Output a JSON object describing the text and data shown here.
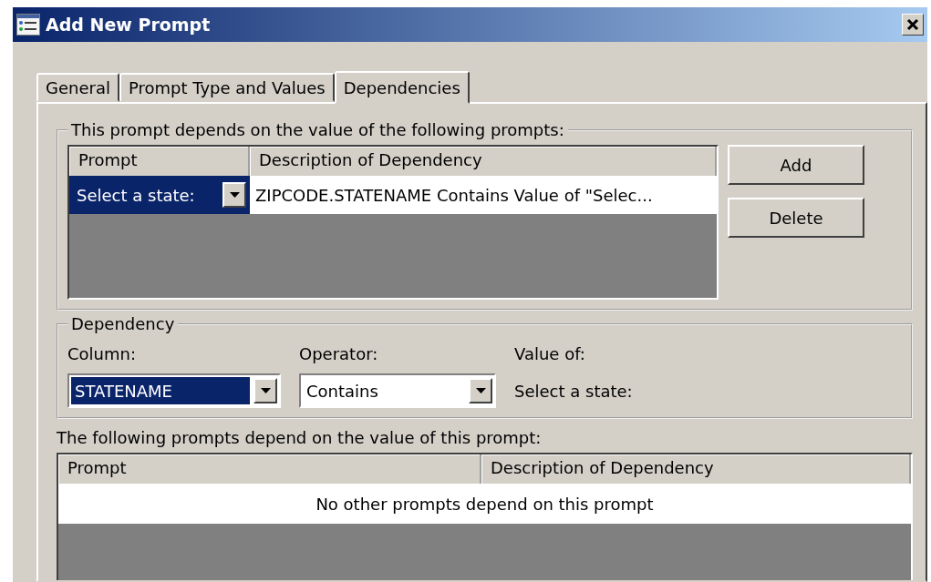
{
  "window": {
    "title": "Add New Prompt"
  },
  "tabs": [
    {
      "label": "General",
      "selected": false
    },
    {
      "label": "Prompt Type and Values",
      "selected": false
    },
    {
      "label": "Dependencies",
      "selected": true
    }
  ],
  "depends_on": {
    "legend": "This prompt depends on the value of the following prompts:",
    "columns": [
      "Prompt",
      "Description of Dependency"
    ],
    "rows": [
      {
        "prompt": "Select a state:",
        "description": "ZIPCODE.STATENAME Contains Value of \"Selec...",
        "selected": true
      }
    ],
    "buttons": [
      "Add",
      "Delete"
    ]
  },
  "dependency": {
    "legend": "Dependency",
    "column_label": "Column:",
    "column_value": "STATENAME",
    "operator_label": "Operator:",
    "operator_value": "Contains",
    "value_label": "Value of:",
    "value_text": "Select a state:"
  },
  "dependents": {
    "caption": "The following prompts depend on the value of this prompt:",
    "columns": [
      "Prompt",
      "Description of Dependency"
    ],
    "empty_message": "No other prompts depend on this prompt"
  }
}
